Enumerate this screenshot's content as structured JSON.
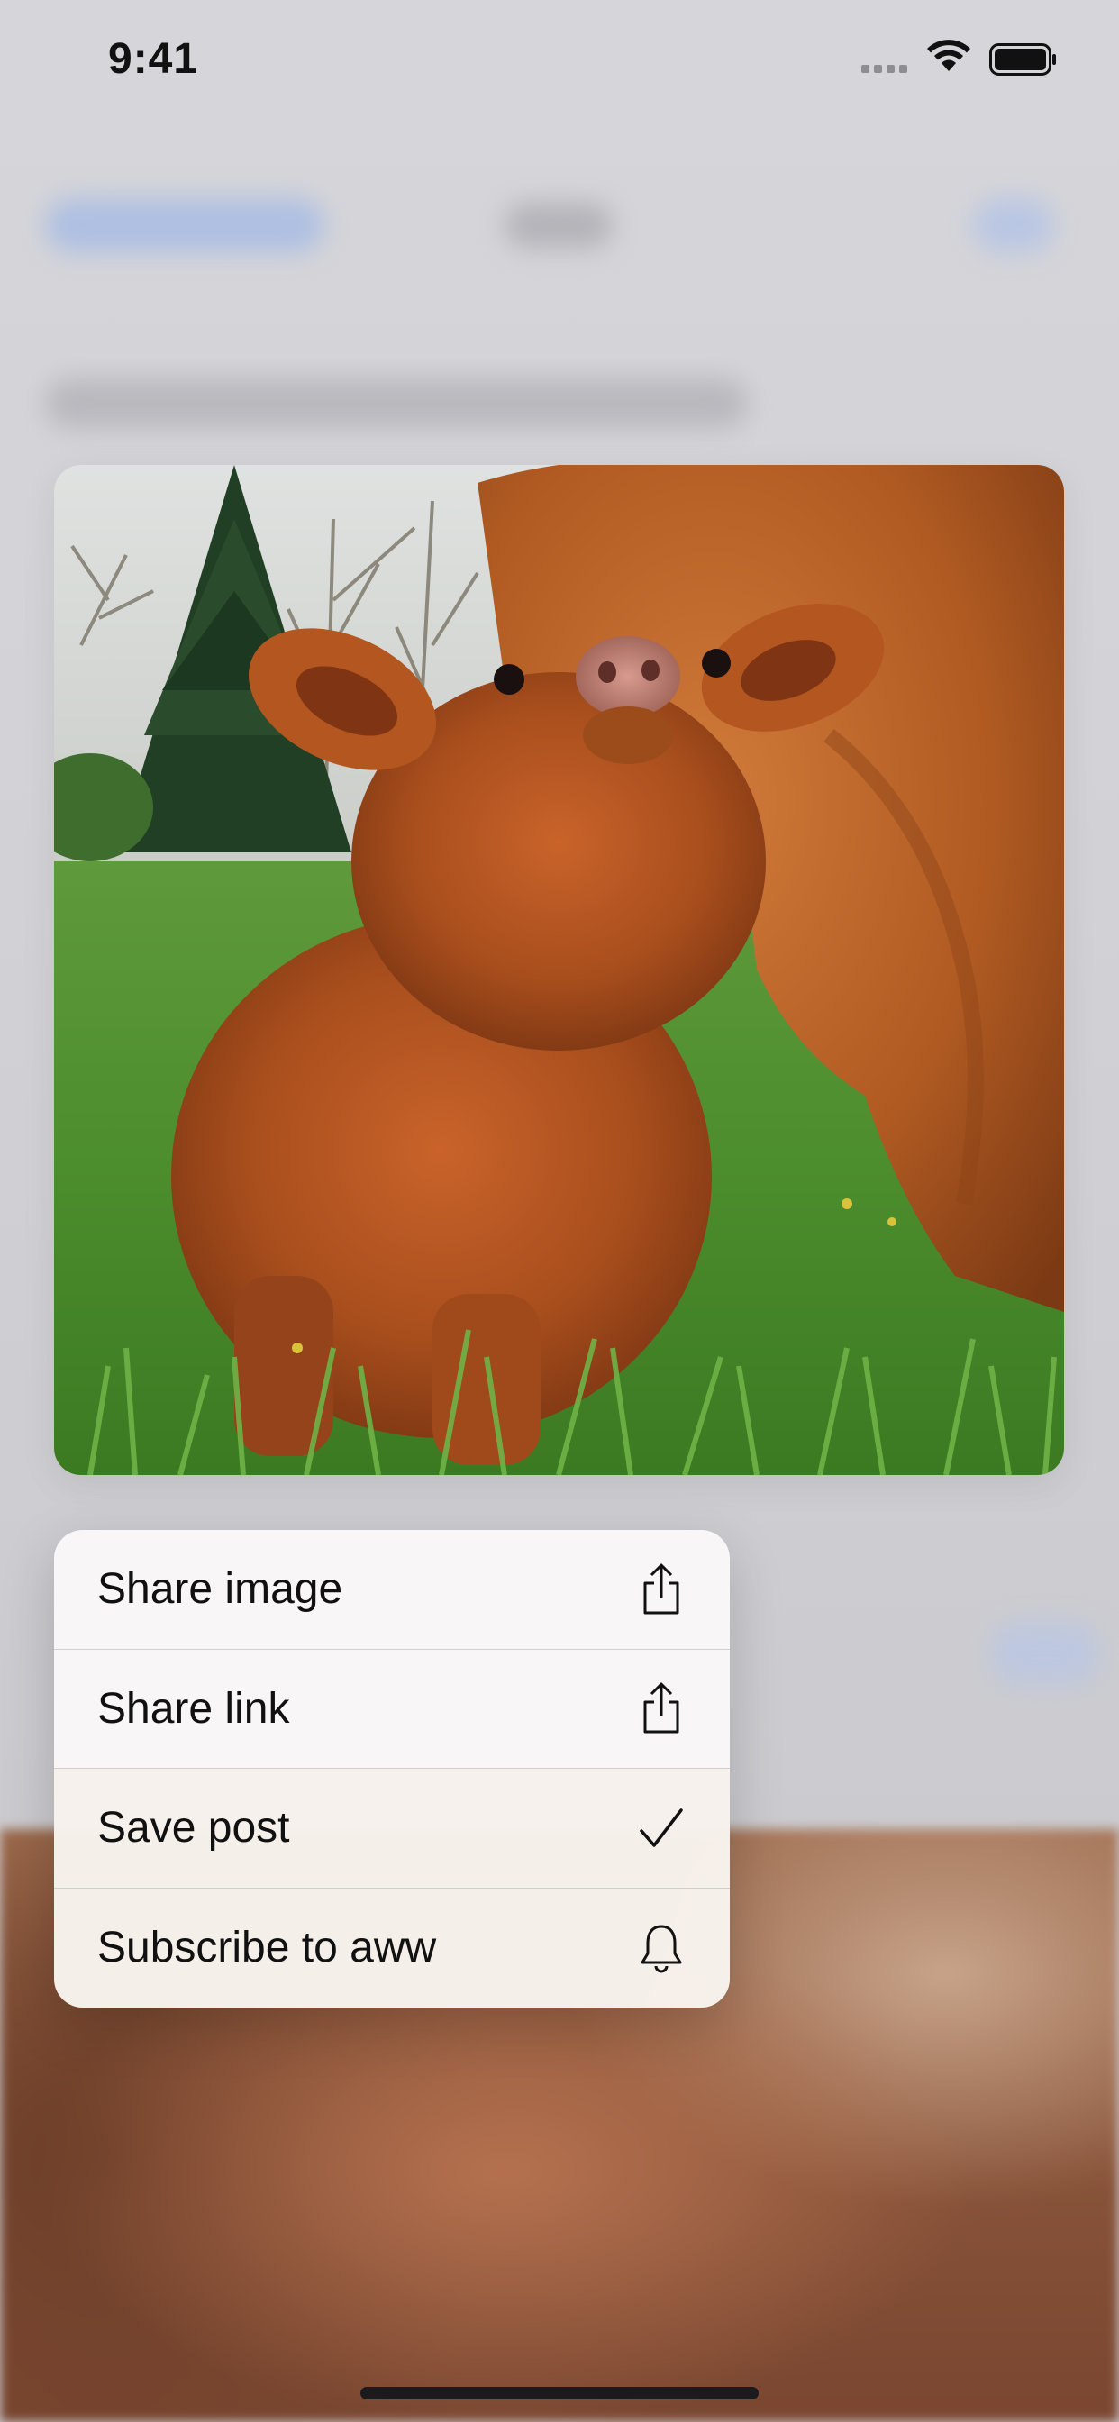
{
  "status_bar": {
    "time": "9:41"
  },
  "post_image": {
    "subject": "highland calf standing in grass"
  },
  "context_menu": {
    "items": [
      {
        "label": "Share image",
        "icon": "share-icon"
      },
      {
        "label": "Share link",
        "icon": "share-icon"
      },
      {
        "label": "Save post",
        "icon": "checkmark-icon"
      },
      {
        "label": "Subscribe to aww",
        "icon": "bell-icon"
      }
    ]
  },
  "colors": {
    "menu_background": "#f6f4f3",
    "text": "#111111",
    "separator": "#d1cfcd"
  }
}
